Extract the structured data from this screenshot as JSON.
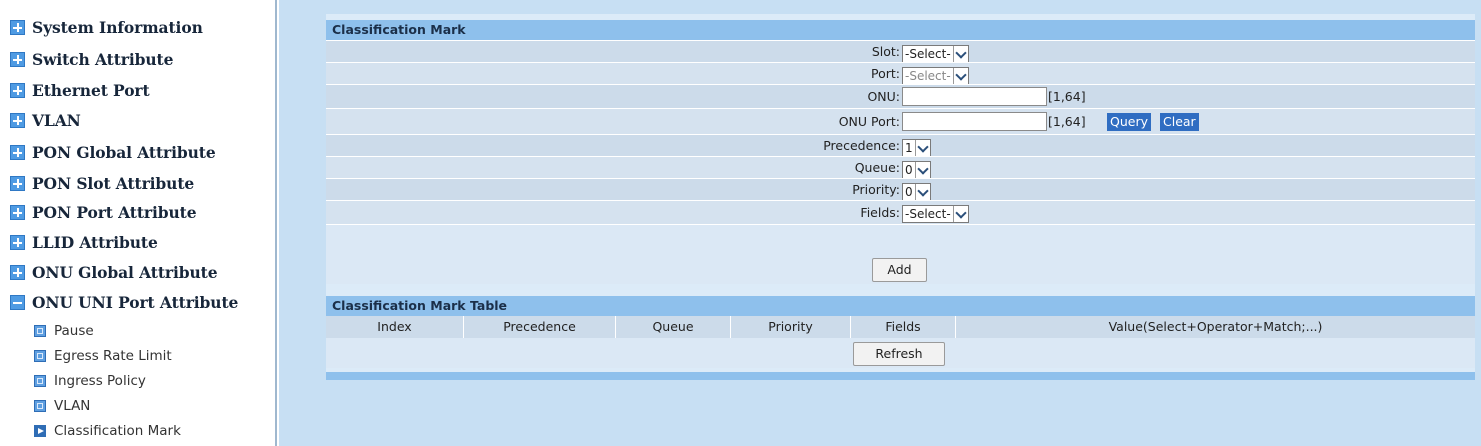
{
  "sidebar": {
    "items": [
      {
        "label": "System Information"
      },
      {
        "label": "Switch Attribute"
      },
      {
        "label": "Ethernet Port"
      },
      {
        "label": "VLAN"
      },
      {
        "label": "PON Global Attribute"
      },
      {
        "label": "PON Slot Attribute"
      },
      {
        "label": "PON Port Attribute"
      },
      {
        "label": "LLID Attribute"
      },
      {
        "label": "ONU Global Attribute"
      },
      {
        "label": "ONU UNI Port Attribute"
      }
    ],
    "subitems": [
      {
        "label": "Pause"
      },
      {
        "label": "Egress Rate Limit"
      },
      {
        "label": "Ingress Policy"
      },
      {
        "label": "VLAN"
      },
      {
        "label": "Classification Mark"
      }
    ]
  },
  "form": {
    "title": "Classification Mark",
    "slot_label": "Slot:",
    "slot_value": "-Select-",
    "port_label": "Port:",
    "port_value": "-Select-",
    "onu_label": "ONU:",
    "onu_value": "",
    "onu_range": "[1,64]",
    "onu_port_label": "ONU Port:",
    "onu_port_value": "",
    "onu_port_range": "[1,64]",
    "query_label": "Query",
    "clear_label": "Clear",
    "precedence_label": "Precedence:",
    "precedence_value": "1",
    "queue_label": "Queue:",
    "queue_value": "0",
    "priority_label": "Priority:",
    "priority_value": "0",
    "fields_label": "Fields:",
    "fields_value": "-Select-",
    "add_label": "Add"
  },
  "table": {
    "title": "Classification Mark Table",
    "columns": [
      "Index",
      "Precedence",
      "Queue",
      "Priority",
      "Fields",
      "Value(Select+Operator+Match;...)"
    ],
    "refresh_label": "Refresh"
  },
  "colors": {
    "section_header": "#8ec0ec",
    "action_button": "#2f6dc2",
    "content_background": "#c7dff3"
  }
}
